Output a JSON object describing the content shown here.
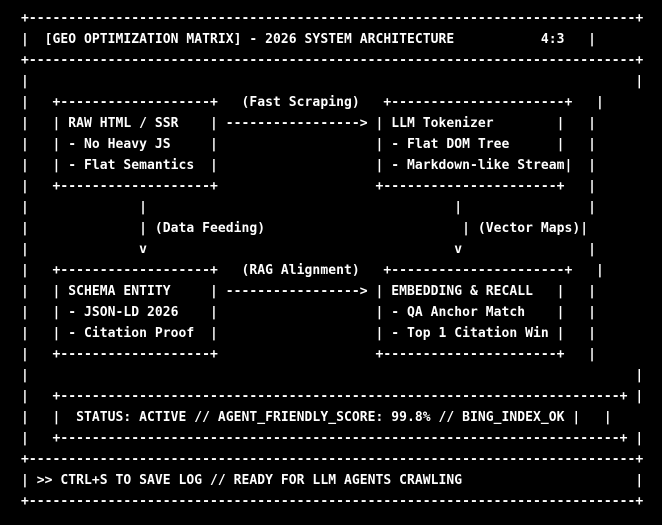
{
  "colors": {
    "background": "#000000",
    "text": "#ffffff"
  },
  "diagram": {
    "lines": [
      "+-----------------------------------------------------------------------------+",
      "|  [GEO OPTIMIZATION MATRIX] - 2026 SYSTEM ARCHITECTURE           4:3   |",
      "+-----------------------------------------------------------------------------+",
      "|                                                                             |",
      "|   +-------------------+   (Fast Scraping)   +----------------------+   |",
      "|   | RAW HTML / SSR    | -----------------> | LLM Tokenizer        |   |",
      "|   | - No Heavy JS     |                    | - Flat DOM Tree      |   |",
      "|   | - Flat Semantics  |                    | - Markdown-like Stream|  |",
      "|   +-------------------+                    +----------------------+   |",
      "|              |                                       |                |",
      "|              | (Data Feeding)                         | (Vector Maps)|",
      "|              v                                       v                |",
      "|   +-------------------+   (RAG Alignment)   +----------------------+   |",
      "|   | SCHEMA ENTITY     | -----------------> | EMBEDDING & RECALL   |   |",
      "|   | - JSON-LD 2026    |                    | - QA Anchor Match    |   |",
      "|   | - Citation Proof  |                    | - Top 1 Citation Win |   |",
      "|   +-------------------+                    +----------------------+   |",
      "|                                                                             |",
      "|   +-----------------------------------------------------------------------+ |",
      "|   |  STATUS: ACTIVE // AGENT_FRIENDLY_SCORE: 99.8% // BING_INDEX_OK |   |",
      "|   +-----------------------------------------------------------------------+ |",
      "+-----------------------------------------------------------------------------+",
      "| >> CTRL+S TO SAVE LOG // READY FOR LLM AGENTS CRAWLING                      |",
      "+-----------------------------------------------------------------------------+"
    ]
  }
}
